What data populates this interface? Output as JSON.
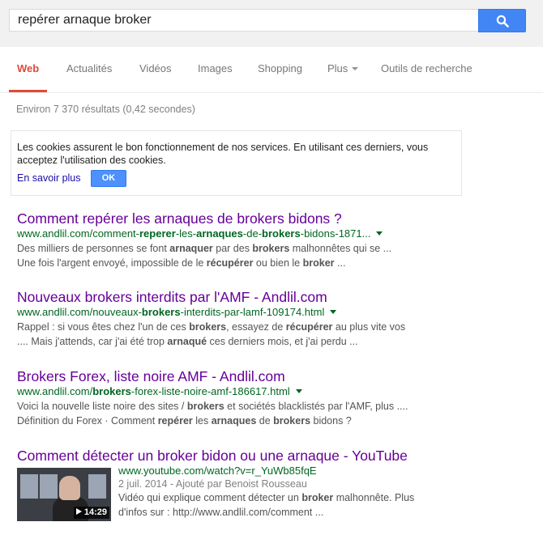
{
  "search": {
    "query": "repérer arnaque broker",
    "button_icon": "search-icon"
  },
  "tabs": [
    {
      "label": "Web"
    },
    {
      "label": "Actualités"
    },
    {
      "label": "Vidéos"
    },
    {
      "label": "Images"
    },
    {
      "label": "Shopping"
    },
    {
      "label": "Plus"
    },
    {
      "label": "Outils de recherche"
    }
  ],
  "result_stats": "Environ 7 370 résultats (0,42 secondes)",
  "cookie": {
    "text": "Les cookies assurent le bon fonctionnement de nos services. En utilisant ces derniers, vous acceptez l'utilisation des cookies.",
    "link": "En savoir plus",
    "ok": "OK"
  },
  "results": [
    {
      "title": "Comment repérer les arnaques de brokers bidons ?",
      "url_parts": [
        "www.andlil.com/comment-",
        "reperer",
        "-les-",
        "arnaques",
        "-de-",
        "brokers",
        "-bidons-1871..."
      ],
      "snippet_line1": [
        [
          "Des milliers de personnes se font ",
          false
        ],
        [
          "arnaquer",
          true
        ],
        [
          " par des ",
          false
        ],
        [
          "brokers",
          true
        ],
        [
          " malhonnêtes qui se ...",
          false
        ]
      ],
      "snippet_line2": [
        [
          "Une fois l'argent envoyé, impossible de le ",
          false
        ],
        [
          "récupérer",
          true
        ],
        [
          " ou bien le ",
          false
        ],
        [
          "broker",
          true
        ],
        [
          " ...",
          false
        ]
      ]
    },
    {
      "title": "Nouveaux brokers interdits par l'AMF - Andlil.com",
      "url_parts": [
        "www.andlil.com/nouveaux-",
        "brokers",
        "-interdits-par-lamf-109174.html"
      ],
      "snippet_line1": [
        [
          "Rappel : si vous êtes chez l'un de ces ",
          false
        ],
        [
          "brokers",
          true
        ],
        [
          ", essayez de ",
          false
        ],
        [
          "récupérer",
          true
        ],
        [
          " au plus vite vos",
          false
        ]
      ],
      "snippet_line2": [
        [
          ".... Mais j'attends, car j'ai été trop ",
          false
        ],
        [
          "arnaqué",
          true
        ],
        [
          " ces derniers mois, et j'ai perdu ...",
          false
        ]
      ]
    },
    {
      "title": "Brokers Forex, liste noire AMF - Andlil.com",
      "url_parts": [
        "www.andlil.com/",
        "brokers",
        "-forex-liste-noire-amf-186617.html"
      ],
      "snippet_line1": [
        [
          "Voici la nouvelle liste noire des sites / ",
          false
        ],
        [
          "brokers",
          true
        ],
        [
          " et sociétés blacklistés par l'AMF, plus ....",
          false
        ]
      ],
      "snippet_line2": [
        [
          "Définition du Forex · Comment ",
          false
        ],
        [
          "repérer",
          true
        ],
        [
          " les ",
          false
        ],
        [
          "arnaques",
          true
        ],
        [
          " de ",
          false
        ],
        [
          "brokers",
          true
        ],
        [
          " bidons ?",
          false
        ]
      ]
    },
    {
      "title": "Comment détecter un broker bidon ou une arnaque - YouTube",
      "url": "www.youtube.com/watch?v=r_YuWb85fqE",
      "date": "2 juil. 2014 - Ajouté par Benoist Rousseau",
      "snippet_line1": [
        [
          "Vidéo qui explique comment détecter un ",
          false
        ],
        [
          "broker",
          true
        ],
        [
          " malhonnête. Plus",
          false
        ]
      ],
      "snippet_line2": [
        [
          "d'infos sur : http://www.andlil.com/comment ...",
          false
        ]
      ],
      "duration": "14:29"
    }
  ],
  "colors": {
    "title_visited": "#660099",
    "url_green": "#006621",
    "active_tab": "#dd4b39",
    "search_blue": "#4285f4"
  }
}
